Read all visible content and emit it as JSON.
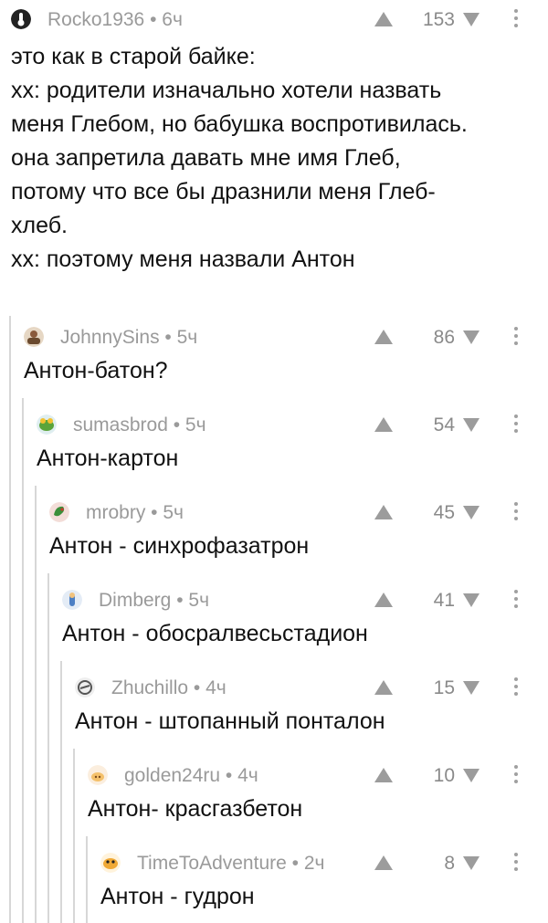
{
  "comments": [
    {
      "author": "Rocko1936",
      "sep": " • ",
      "time": "6ч",
      "score": "153",
      "avatar_icon": "hand-icon",
      "lines": [
        "это как в старой байке:",
        "хх: родители изначально хотели назвать",
        "меня Глебом, но бабушка воспротивилась.",
        "она запретила давать мне имя Глеб,",
        "потому что все бы дразнили меня Глеб-",
        "хлеб.",
        "хх: поэтому меня назвали Антон"
      ]
    },
    {
      "author": "JohnnySins",
      "sep": " • ",
      "time": "5ч",
      "score": "86",
      "avatar_icon": "muscle-man-avatar",
      "lines": [
        "Антон-батон?"
      ]
    },
    {
      "author": "sumasbrod",
      "sep": " • ",
      "time": "5ч",
      "score": "54",
      "avatar_icon": "frog-avatar",
      "lines": [
        "Антон-картон"
      ]
    },
    {
      "author": "mrobry",
      "sep": " • ",
      "time": "5ч",
      "score": "45",
      "avatar_icon": "parrot-avatar",
      "lines": [
        "Антон - синхрофазатрон"
      ]
    },
    {
      "author": "Dimberg",
      "sep": " • ",
      "time": "5ч",
      "score": "41",
      "avatar_icon": "cartoon-character-avatar",
      "lines": [
        "Антон - обосралвесьстадион"
      ]
    },
    {
      "author": "Zhuchillo",
      "sep": " • ",
      "time": "4ч",
      "score": "15",
      "avatar_icon": "sketch-avatar",
      "lines": [
        "Антон - штопанный понталон"
      ]
    },
    {
      "author": "golden24ru",
      "sep": " • ",
      "time": "4ч",
      "score": "10",
      "avatar_icon": "pig-avatar",
      "lines": [
        "Антон- красгазбетон"
      ]
    },
    {
      "author": "TimeToAdventure",
      "sep": " • ",
      "time": "2ч",
      "score": "8",
      "avatar_icon": "jake-dog-avatar",
      "lines": [
        "Антон - гудрон"
      ]
    }
  ]
}
